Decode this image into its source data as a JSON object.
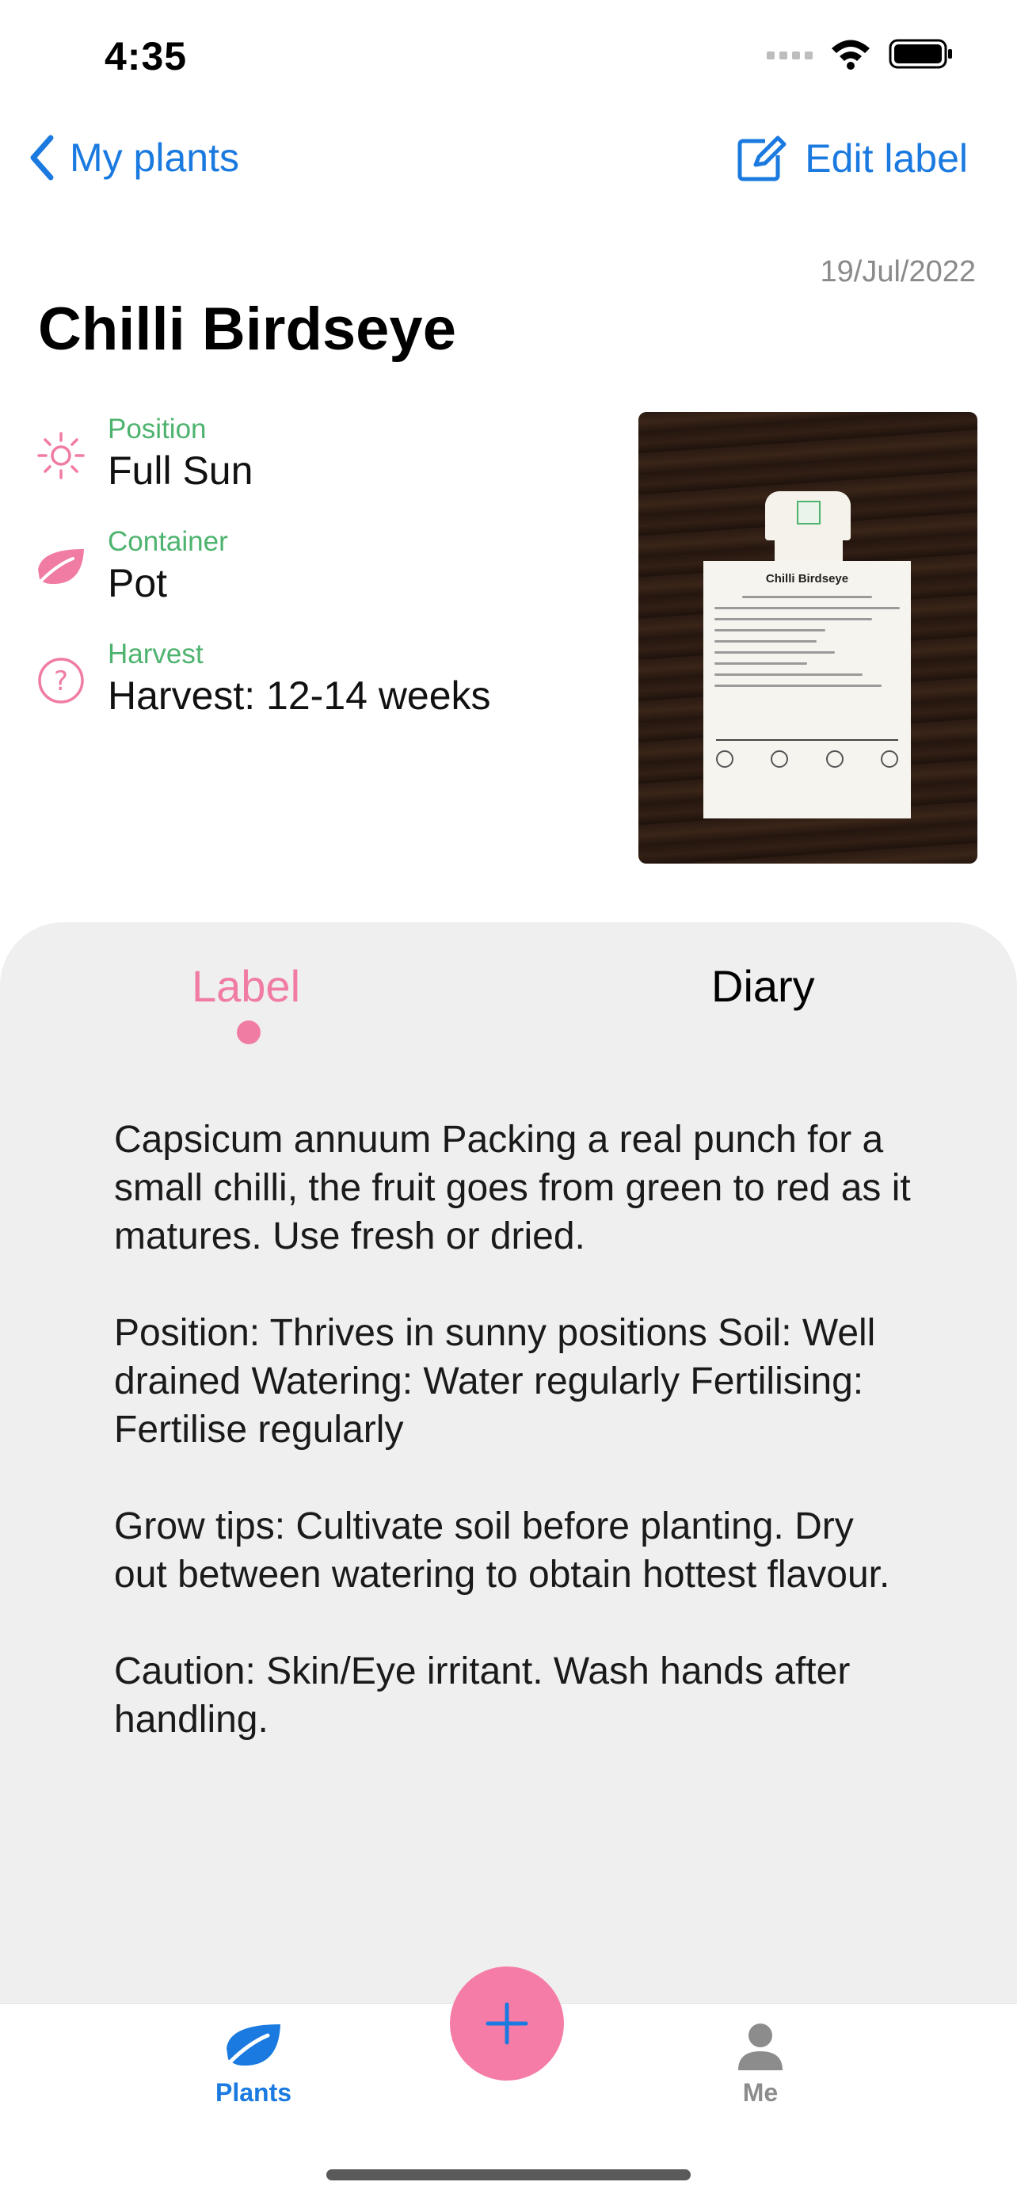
{
  "status": {
    "time": "4:35"
  },
  "nav": {
    "back_label": "My plants",
    "edit_label": "Edit label"
  },
  "plant": {
    "date": "19/Jul/2022",
    "name": "Chilli Birdseye",
    "attributes": [
      {
        "label": "Position",
        "value": "Full Sun",
        "icon": "sun-icon"
      },
      {
        "label": "Container",
        "value": "Pot",
        "icon": "leaf-icon"
      },
      {
        "label": "Harvest",
        "value": "Harvest: 12-14 weeks",
        "icon": "question-icon"
      }
    ],
    "photo_card_title": "Chilli Birdseye"
  },
  "tabs": {
    "label": "Label",
    "diary": "Diary",
    "active": "Label"
  },
  "label_text": [
    "Capsicum annuum Packing a real punch for a small chilli, the fruit goes from green to red as it matures. Use fresh or dried.",
    "Position: Thrives in sunny positions Soil: Well drained Watering: Water regularly Fertilising: Fertilise regularly",
    "Grow tips: Cultivate soil before planting. Dry out between watering to obtain hottest flavour.",
    "Caution: Skin/Eye irritant. Wash hands after handling."
  ],
  "tabbar": {
    "plants": "Plants",
    "me": "Me",
    "add_icon": "plus-icon"
  },
  "colors": {
    "accent_blue": "#1a7ae0",
    "pink": "#f07ca4",
    "green_label": "#4db36e",
    "panel_bg": "#efefef"
  }
}
